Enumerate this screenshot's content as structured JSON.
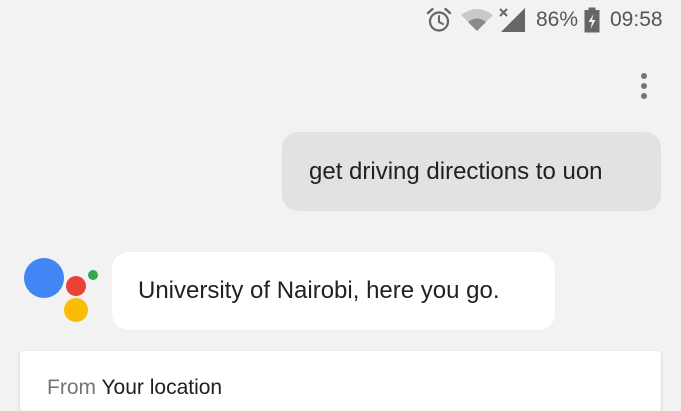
{
  "status_bar": {
    "alarm_icon": "alarm-clock-icon",
    "wifi_icon": "wifi-icon",
    "signal_icon": "cell-signal-icon",
    "battery_percent": "86%",
    "battery_icon": "battery-charging-icon",
    "time": "09:58"
  },
  "toolbar": {
    "overflow_icon": "more-vert-icon"
  },
  "conversation": {
    "user_query": "get driving directions to uon",
    "assistant_reply": "University of Nairobi, here you go."
  },
  "directions_card": {
    "from_label": "From",
    "from_value": "Your location"
  },
  "colors": {
    "background": "#f2f2f2",
    "user_bubble": "#e2e2e2",
    "assistant_bubble": "#ffffff",
    "google_blue": "#4285f4",
    "google_red": "#ea4335",
    "google_yellow": "#fbbc05",
    "google_green": "#34a853"
  }
}
